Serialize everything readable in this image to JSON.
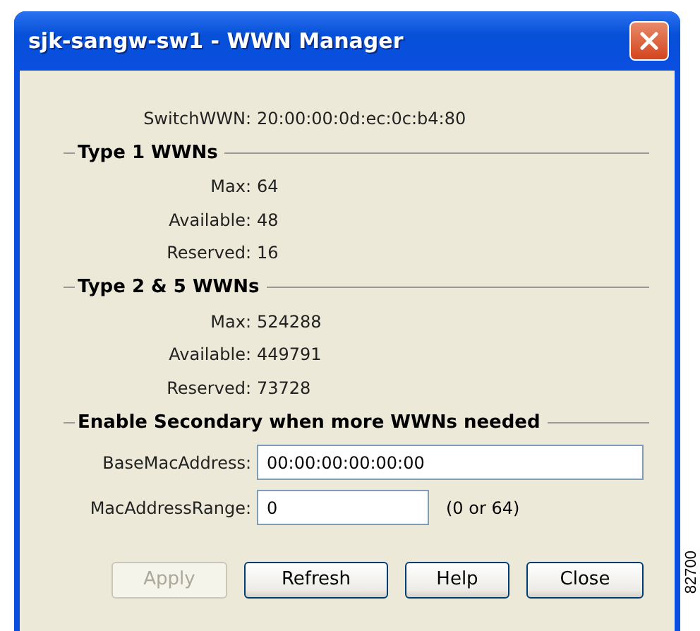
{
  "window": {
    "title": "sjk-sangw-sw1 - WWN Manager"
  },
  "switch_wwn": {
    "label": "SwitchWWN:",
    "value": "20:00:00:0d:ec:0c:b4:80"
  },
  "groups": [
    {
      "title": "Type 1 WWNs",
      "rows": [
        {
          "label": "Max:",
          "value": "64"
        },
        {
          "label": "Available:",
          "value": "48"
        },
        {
          "label": "Reserved:",
          "value": "16"
        }
      ]
    },
    {
      "title": "Type 2 & 5 WWNs",
      "rows": [
        {
          "label": "Max:",
          "value": "524288"
        },
        {
          "label": "Available:",
          "value": "449791"
        },
        {
          "label": "Reserved:",
          "value": "73728"
        }
      ]
    }
  ],
  "secondary": {
    "title": "Enable Secondary when more WWNs needed",
    "fields": [
      {
        "label": "BaseMacAddress:",
        "value": "00:00:00:00:00:00",
        "kind": "wide"
      },
      {
        "label": "MacAddressRange:",
        "value": "0",
        "kind": "narrow",
        "hint": "(0 or 64)"
      }
    ]
  },
  "buttons": [
    {
      "label": "Apply",
      "disabled": true
    },
    {
      "label": "Refresh",
      "disabled": false
    },
    {
      "label": "Help",
      "disabled": false
    },
    {
      "label": "Close",
      "disabled": false
    }
  ],
  "figure_number": "82700"
}
